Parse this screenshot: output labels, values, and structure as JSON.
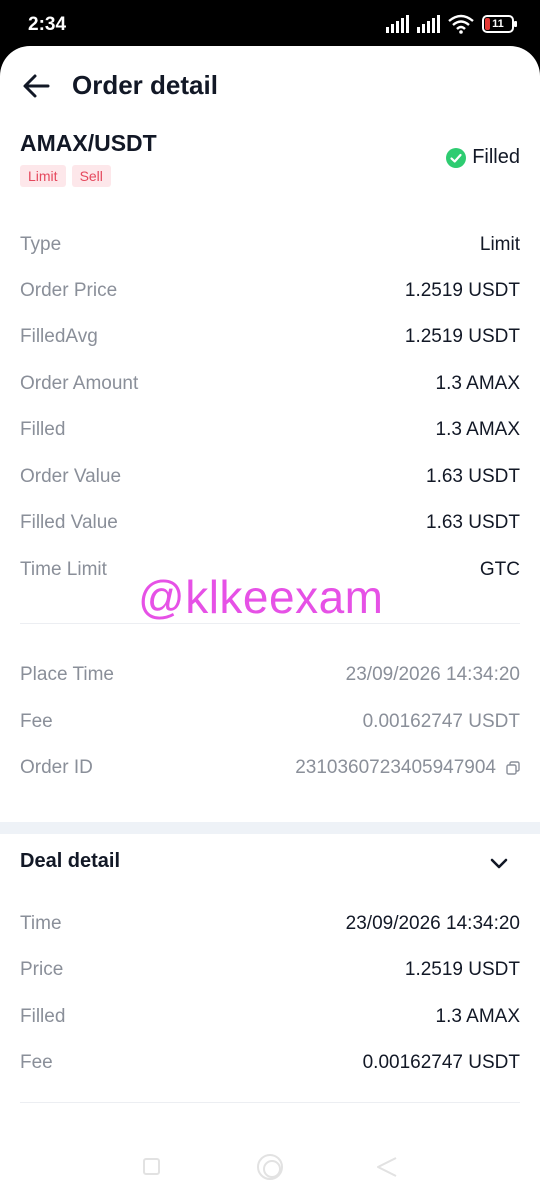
{
  "status_bar": {
    "time": "2:34",
    "battery": "11"
  },
  "header": {
    "title": "Order detail"
  },
  "order": {
    "pair": "AMAX/USDT",
    "tags": [
      "Limit",
      "Sell"
    ],
    "status": "Filled",
    "details": [
      {
        "label": "Type",
        "value": "Limit"
      },
      {
        "label": "Order Price",
        "value": "1.2519 USDT"
      },
      {
        "label": "FilledAvg",
        "value": "1.2519 USDT"
      },
      {
        "label": "Order Amount",
        "value": "1.3 AMAX"
      },
      {
        "label": "Filled",
        "value": "1.3 AMAX"
      },
      {
        "label": "Order Value",
        "value": "1.63 USDT"
      },
      {
        "label": "Filled Value",
        "value": "1.63 USDT"
      },
      {
        "label": "Time Limit",
        "value": "GTC"
      }
    ],
    "meta": [
      {
        "label": "Place Time",
        "value": "23/09/2026 14:34:20"
      },
      {
        "label": "Fee",
        "value": "0.00162747 USDT"
      },
      {
        "label": "Order ID",
        "value": "2310360723405947904"
      }
    ]
  },
  "deal": {
    "title": "Deal detail",
    "rows": [
      {
        "label": "Time",
        "value": "23/09/2026 14:34:20"
      },
      {
        "label": "Price",
        "value": "1.2519 USDT"
      },
      {
        "label": "Filled",
        "value": "1.3 AMAX"
      },
      {
        "label": "Fee",
        "value": "0.00162747 USDT"
      }
    ]
  },
  "watermark": "@klkeexam",
  "icons": {
    "back": "arrow-left-icon",
    "status": "check-circle-icon",
    "copy": "copy-icon",
    "expand": "chevron-down-icon"
  },
  "colors": {
    "accent_green": "#2ecc71",
    "tag_red": "#e5485d",
    "watermark": "#e651e6"
  }
}
